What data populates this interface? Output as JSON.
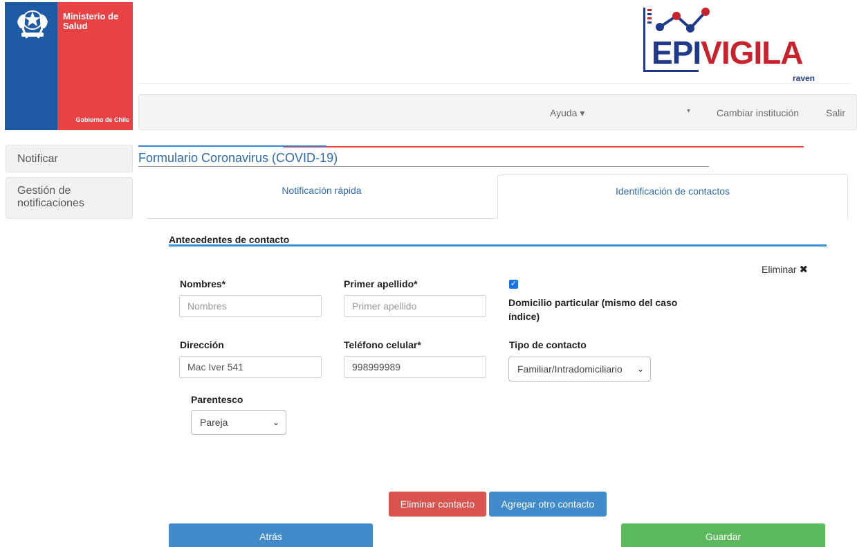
{
  "gov": {
    "ministerio": "Ministerio de Salud",
    "gobierno": "Gobierno de Chile"
  },
  "brand": {
    "name_epi": "EPI",
    "name_vigila": "VIGILA",
    "sub": "raven"
  },
  "nav": {
    "ayuda": "Ayuda ▾",
    "caret": "▾",
    "cambiar": "Cambiar institución",
    "salir": "Salir"
  },
  "sidebar": {
    "items": [
      {
        "label": "Notificar"
      },
      {
        "label": "Gestión de notificaciones"
      }
    ]
  },
  "form": {
    "title": "Formulario Coronavirus (COVID-19)",
    "tabs": [
      {
        "label": "Notificación rápida"
      },
      {
        "label": "Identificación de contactos"
      }
    ],
    "section_title": "Antecedentes de contacto",
    "eliminar": "Eliminar",
    "fields": {
      "nombres": {
        "label": "Nombres*",
        "placeholder": "Nombres",
        "value": ""
      },
      "apellido": {
        "label": "Primer apellido*",
        "placeholder": "Primer apellido",
        "value": ""
      },
      "domicilio": {
        "label": "Domicilio particular (mismo del caso índice)",
        "checked": true
      },
      "direccion": {
        "label": "Dirección",
        "value": "Mac Iver 541"
      },
      "telefono": {
        "label": "Teléfono celular*",
        "value": "998999989"
      },
      "tipo": {
        "label": "Tipo de contacto",
        "value": "Familiar/Intradomiciliario"
      },
      "parentesco": {
        "label": "Parentesco",
        "value": "Pareja"
      }
    },
    "buttons": {
      "eliminar_contacto": "Eliminar contacto",
      "agregar_contacto": "Agregar otro contacto",
      "atras": "Atrás",
      "guardar": "Guardar"
    }
  },
  "colors": {
    "gov_blue": "#1f5aa5",
    "gov_red": "#e84245",
    "link_blue": "#2d6ab0",
    "danger": "#d9534f",
    "primary": "#428bca",
    "success": "#5cb85c"
  }
}
